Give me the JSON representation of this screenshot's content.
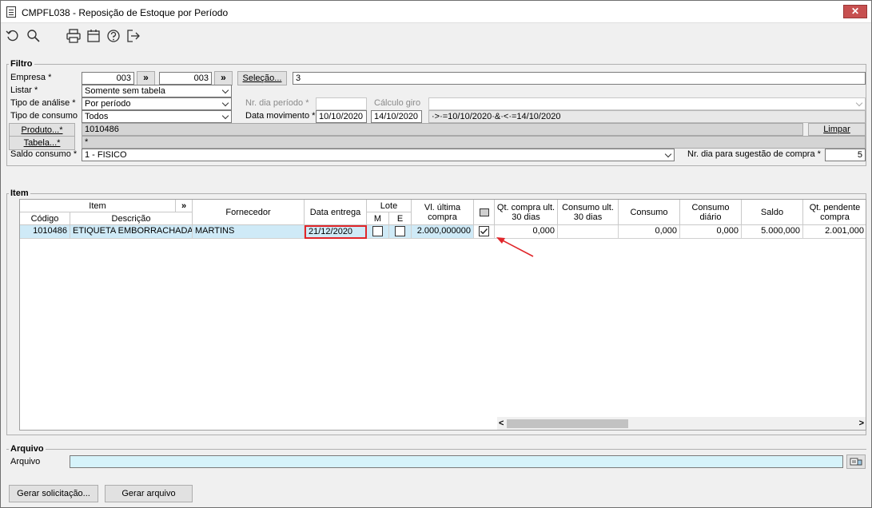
{
  "window": {
    "title": "CMPFL038 - Reposição de Estoque por Período",
    "close_glyph": "✕"
  },
  "toolbar": [
    "undo-icon",
    "search-icon",
    "print-icon",
    "calendar-icon",
    "help-icon",
    "exit-icon"
  ],
  "filtro": {
    "title": "Filtro",
    "empresa": {
      "label": "Empresa *",
      "from": "003",
      "to": "003",
      "jump": "»"
    },
    "selecao": {
      "label": "Seleção...",
      "value": "3"
    },
    "listar": {
      "label": "Listar *",
      "value": "Somente sem tabela"
    },
    "tipo_analise": {
      "label": "Tipo de análise *",
      "value": "Por período"
    },
    "nr_dia_periodo": {
      "label": "Nr. dia período *",
      "value": ""
    },
    "calculo_giro": {
      "label": "Cálculo giro",
      "value": ""
    },
    "tipo_consumo": {
      "label": "Tipo de consumo",
      "value": "Todos"
    },
    "data_movimento": {
      "label": "Data movimento *",
      "from": "10/10/2020",
      "to": "14/10/2020",
      "expr": "·>·=10/10/2020·&·<·=14/10/2020"
    },
    "produto": {
      "label": "Produto...*",
      "value": "1010486",
      "limpar": "Limpar"
    },
    "tabela": {
      "label": "Tabela...*",
      "value": "*"
    },
    "saldo_consumo": {
      "label": "Saldo consumo *",
      "value": "1 - FISICO"
    },
    "nr_dia_sugestao": {
      "label": "Nr. dia para sugestão de compra *",
      "value": "5"
    }
  },
  "item": {
    "title": "Item",
    "headers": {
      "item": "Item",
      "expand": "»",
      "codigo": "Código",
      "descricao": "Descrição",
      "fornecedor": "Fornecedor",
      "data_entrega": "Data entrega",
      "lote": "Lote",
      "lote_m": "M",
      "lote_e": "E",
      "vl_ultima_compra": "Vl. última compra",
      "qt_compra_30": "Qt. compra ult. 30 dias",
      "consumo_30": "Consumo ult. 30 dias",
      "consumo": "Consumo",
      "consumo_diario": "Consumo diário",
      "saldo": "Saldo",
      "qt_pendente": "Qt. pendente compra"
    },
    "rows": [
      {
        "codigo": "1010486",
        "descricao": "ETIQUETA EMBORRACHADA BAIXO RELEVO",
        "fornecedor": "MARTINS",
        "data_entrega": "21/12/2020",
        "lote_m": false,
        "lote_e": false,
        "vl_ultima_compra": "2.000,000000",
        "selected": true,
        "qt_compra_30": "0,000",
        "consumo_30": "",
        "consumo": "0,000",
        "consumo_diario": "0,000",
        "saldo": "5.000,000",
        "qt_pendente": "2.001,000"
      }
    ],
    "scroll_left": "<",
    "scroll_right": ">"
  },
  "arquivo": {
    "title": "Arquivo",
    "label": "Arquivo",
    "value": ""
  },
  "buttons": {
    "gerar_solicitacao": "Gerar solicitação...",
    "gerar_arquivo": "Gerar arquivo"
  },
  "colors": {
    "highlight": "#e0262a",
    "selected_row": "#cfeaf7",
    "file_field": "#d6f3fa"
  }
}
